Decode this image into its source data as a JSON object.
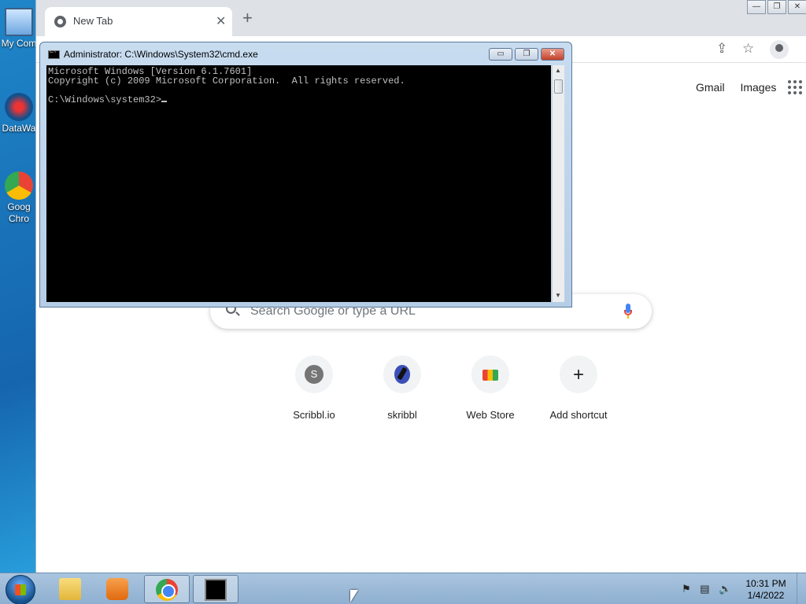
{
  "desktop": {
    "icons": [
      {
        "label": "My Com",
        "icon": "computer-icon"
      },
      {
        "label": "DataWa",
        "icon": "shortcut-icon"
      },
      {
        "label": "Goog",
        "label2": "Chro",
        "icon": "chrome-icon"
      }
    ]
  },
  "chrome": {
    "tab_title": "New Tab",
    "tab_close": "✕",
    "new_tab": "+",
    "window_buttons": [
      "—",
      "❐",
      "✕"
    ],
    "toolbar_icons": [
      "share-icon",
      "star-icon",
      "profile-icon",
      "menu-icon"
    ],
    "links": {
      "gmail": "Gmail",
      "images": "Images"
    },
    "search_placeholder": "Search Google or type a URL",
    "shortcuts": [
      {
        "label": "Scribbl.io",
        "icon": "letter-s-icon",
        "letter": "S"
      },
      {
        "label": "skribbl",
        "icon": "pen-icon"
      },
      {
        "label": "Web Store",
        "icon": "web-store-icon"
      },
      {
        "label": "Add shortcut",
        "icon": "plus-icon",
        "glyph": "+"
      }
    ]
  },
  "cmd": {
    "title": "Administrator: C:\\Windows\\System32\\cmd.exe",
    "lines": [
      "Microsoft Windows [Version 6.1.7601]",
      "Copyright (c) 2009 Microsoft Corporation.  All rights reserved.",
      "",
      "C:\\Windows\\system32>"
    ],
    "buttons": [
      "▭",
      "❐",
      "✕"
    ]
  },
  "taskbar": {
    "apps": [
      "explorer-icon",
      "media-player-icon",
      "chrome-icon",
      "cmd-icon"
    ],
    "active_index": 2,
    "tray_icons": [
      "action-center-icon",
      "network-icon",
      "volume-icon"
    ],
    "clock_time": "10:31 PM",
    "clock_date": "1/4/2022"
  }
}
